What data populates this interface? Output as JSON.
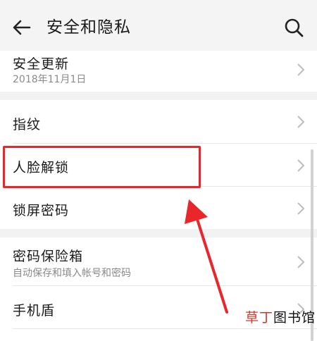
{
  "header": {
    "title": "安全和隐私",
    "back_icon": "arrow-left-icon",
    "search_icon": "search-icon"
  },
  "rows": {
    "security_update": {
      "label": "安全更新",
      "sub": "2018年11月1日"
    },
    "fingerprint": {
      "label": "指纹"
    },
    "face_unlock": {
      "label": "人脸解锁"
    },
    "lock_screen_password": {
      "label": "锁屏密码"
    },
    "password_vault": {
      "label": "密码保险箱",
      "sub": "自动保存和填入帐号和密码"
    },
    "phone_shield": {
      "label": "手机盾"
    }
  },
  "watermark": {
    "part_red": "草丁",
    "part_dark": "图书馆"
  },
  "colors": {
    "highlight": "#e8262b",
    "background": "#ffffff",
    "section_gap": "#f2f2f2"
  }
}
